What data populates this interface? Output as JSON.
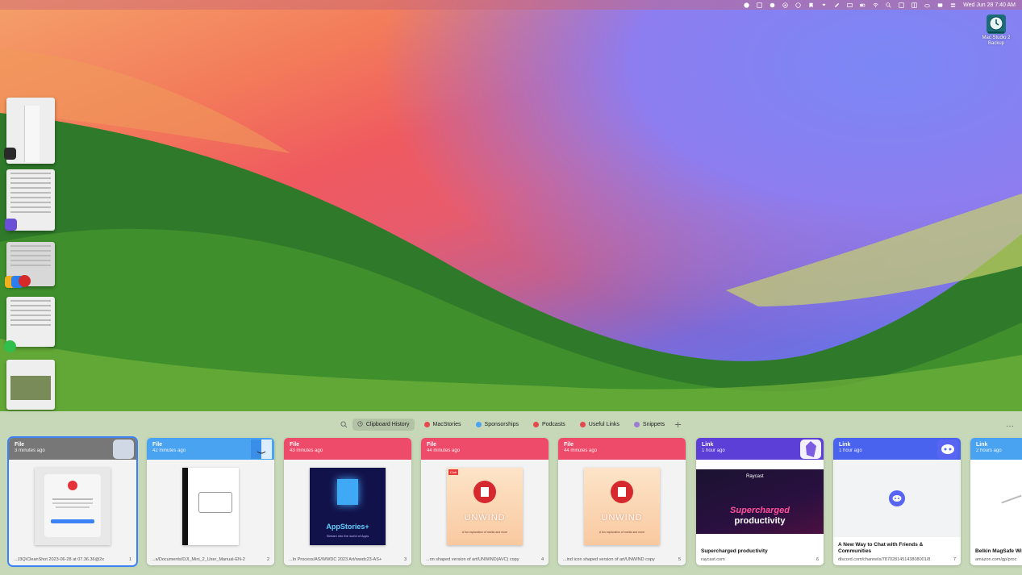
{
  "menubar": {
    "clock": "Wed Jun 28 7:40 AM",
    "icons": [
      "p-icon",
      "grid-icon",
      "moon-icon",
      "broadcast-icon",
      "play-icon",
      "bookmark-icon",
      "dropbox-icon",
      "rocket-icon",
      "window-icon",
      "battery-icon",
      "wifi-icon",
      "search-icon",
      "menu-icon",
      "layout-icon",
      "cloud-icon",
      "timer-icon",
      "control-center-icon"
    ]
  },
  "desktop": {
    "backup_label_1": "Mac Studio 2",
    "backup_label_2": "Backup"
  },
  "toolbar": {
    "tabs": [
      {
        "label": "Clipboard History",
        "color": "#888888",
        "active": true
      },
      {
        "label": "MacStories",
        "color": "#e5484d"
      },
      {
        "label": "Sponsorships",
        "color": "#4aa3f0"
      },
      {
        "label": "Podcasts",
        "color": "#e5484d"
      },
      {
        "label": "Useful Links",
        "color": "#e5484d"
      },
      {
        "label": "Snippets",
        "color": "#9a7bd6"
      }
    ],
    "more": "···"
  },
  "cards": [
    {
      "type": "File",
      "time": "3 minutes ago",
      "footer": "...J3Q\\CleanShot 2023-06-28 at 07.36.36@2x",
      "count": "1",
      "color": "#777777",
      "app": "cleanshot"
    },
    {
      "type": "File",
      "time": "42 minutes ago",
      "footer": "...s/Documents/DJI_Mini_2_User_Manual-EN-2",
      "count": "2",
      "color": "#4aa3f0",
      "app": "finder"
    },
    {
      "type": "File",
      "time": "43 minutes ago",
      "footer": "...In Process/AS/WWDC 2023 Art/wwdc23-AS+",
      "count": "3",
      "color": "#ee4b6a",
      "app": "",
      "thumb_text": "AppStories+",
      "thumb_sub": "Stream into the world of Apps"
    },
    {
      "type": "File",
      "time": "44 minutes ago",
      "footer": "...on shaped version of art/UNWIND(AVC) copy",
      "count": "4",
      "color": "#ee4b6a",
      "app": "",
      "thumb_text": "UNWIND",
      "thumb_sub": "A fun exploration of media and more",
      "thumb_tag": "Club"
    },
    {
      "type": "File",
      "time": "44 minutes ago",
      "footer": "...ind icon shaped version of art/UNWIND copy",
      "count": "5",
      "color": "#ee4b6a",
      "app": "",
      "thumb_text": "UNWIND",
      "thumb_sub": "A fun exploration of media and more"
    },
    {
      "type": "Link",
      "time": "1 hour ago",
      "title": "Supercharged productivity",
      "footer": "raycast.com",
      "count": "6",
      "color": "#5b3fd6",
      "app": "obsidian",
      "thumb_text": "Supercharged",
      "thumb_text2": "productivity",
      "thumb_brand": "Raycast"
    },
    {
      "type": "Link",
      "time": "1 hour ago",
      "title": "A New Way to Chat with Friends & Communities",
      "footer": "discord.com/channels/787028145143808001/8",
      "count": "7",
      "color": "#4a63ee",
      "app": "discord"
    },
    {
      "type": "Link",
      "time": "2 hours ago",
      "title": "Belkin MagSafe Wi Charger - MagSafe",
      "footer": "amazon.com/gp/proc",
      "count": "",
      "color": "#4aa3f0",
      "app": ""
    }
  ]
}
